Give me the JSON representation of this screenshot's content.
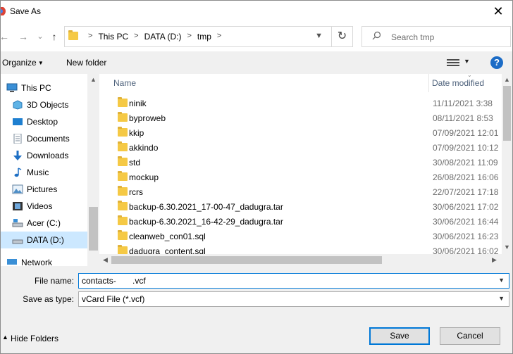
{
  "window": {
    "title": "Save As",
    "close_glyph": "✕"
  },
  "nav": {
    "back_glyph": "←",
    "forward_glyph": "→",
    "recent_glyph": "⌄",
    "up_glyph": "↑",
    "breadcrumbs": [
      "This PC",
      "DATA (D:)",
      "tmp"
    ],
    "crumb_sep": ">",
    "refresh_glyph": "↻",
    "search_placeholder": "Search tmp"
  },
  "toolbar": {
    "organize": "Organize",
    "new_folder": "New folder",
    "help": "?"
  },
  "sidebar": {
    "items": [
      {
        "label": "This PC",
        "icon": "pc-icon"
      },
      {
        "label": "3D Objects",
        "icon": "3d-objects-icon"
      },
      {
        "label": "Desktop",
        "icon": "desktop-icon"
      },
      {
        "label": "Documents",
        "icon": "documents-icon"
      },
      {
        "label": "Downloads",
        "icon": "downloads-icon"
      },
      {
        "label": "Music",
        "icon": "music-icon"
      },
      {
        "label": "Pictures",
        "icon": "pictures-icon"
      },
      {
        "label": "Videos",
        "icon": "videos-icon"
      },
      {
        "label": "Acer (C:)",
        "icon": "drive-icon"
      },
      {
        "label": "DATA (D:)",
        "icon": "drive-icon",
        "selected": true
      },
      {
        "label": "Network",
        "icon": "network-icon"
      }
    ]
  },
  "filelist": {
    "columns": {
      "name": "Name",
      "date": "Date modified"
    },
    "rows": [
      {
        "name": "ninik",
        "date": "11/11/2021 3:38"
      },
      {
        "name": "byproweb",
        "date": "08/11/2021 8:53"
      },
      {
        "name": "kkip",
        "date": "07/09/2021 12:01"
      },
      {
        "name": "akkindo",
        "date": "07/09/2021 10:12"
      },
      {
        "name": "std",
        "date": "30/08/2021 11:09"
      },
      {
        "name": "mockup",
        "date": "26/08/2021 16:06"
      },
      {
        "name": "rcrs",
        "date": "22/07/2021 17:18"
      },
      {
        "name": "backup-6.30.2021_17-00-47_dadugra.tar",
        "date": "30/06/2021 17:02"
      },
      {
        "name": "backup-6.30.2021_16-42-29_dadugra.tar",
        "date": "30/06/2021 16:44"
      },
      {
        "name": "cleanweb_con01.sql",
        "date": "30/06/2021 16:23"
      },
      {
        "name": "dadugra_content.sql",
        "date": "30/06/2021 16:02"
      }
    ]
  },
  "form": {
    "file_name_label": "File name:",
    "file_name_value": "contacts-       .vcf",
    "save_as_type_label": "Save as type:",
    "save_as_type_value": "vCard File (*.vcf)"
  },
  "footer": {
    "hide_folders": "Hide Folders",
    "save": "Save",
    "cancel": "Cancel"
  },
  "colors": {
    "accent": "#0078d7",
    "selected_bg": "#cce8ff",
    "folder": "#f5c945",
    "header_text": "#4c607a"
  }
}
